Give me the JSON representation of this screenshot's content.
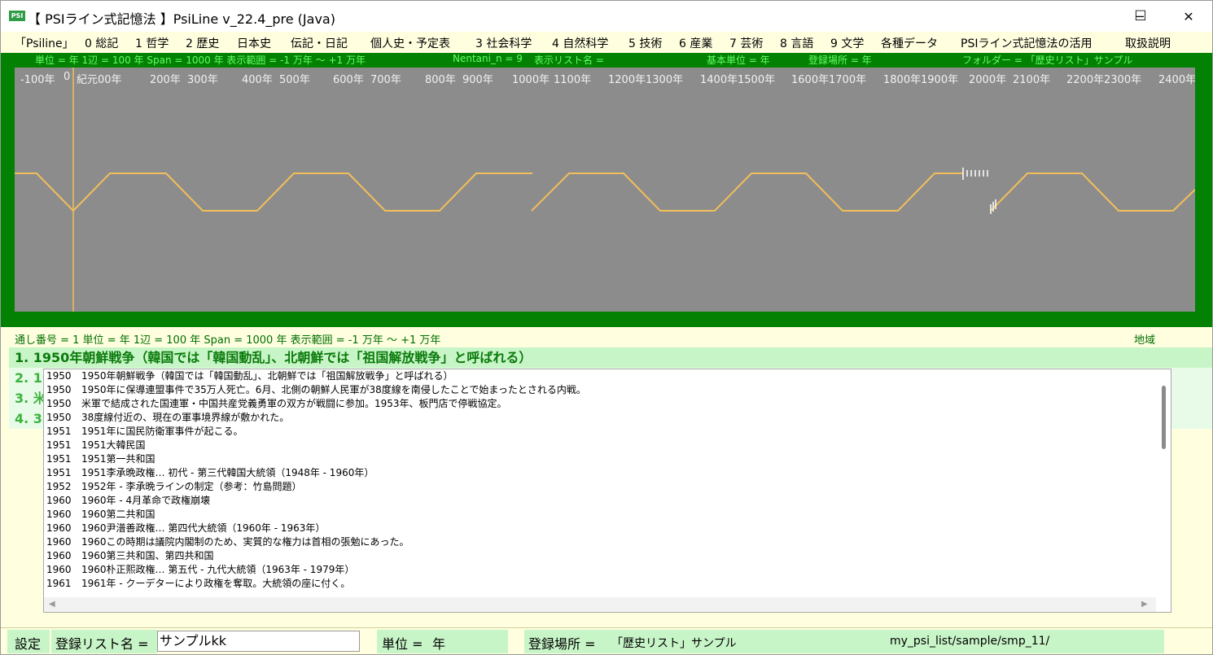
{
  "window": {
    "icon_label": "PSI",
    "title": "【 PSIライン式記憶法 】PsiLine v_22.4_pre (Java)",
    "minimize_glyph": "─",
    "maximize_glyph": "☐",
    "close_glyph": "✕"
  },
  "menu": [
    "「Psiline」",
    "0 総記",
    "1 哲学",
    "2 歴史",
    "日本史",
    "伝記・日記",
    "個人史・予定表",
    "3 社会科学",
    "4 自然科学",
    "5 技術",
    "6 産業",
    "7 芸術",
    "8 言語",
    "9 文学",
    "各種データ",
    "PSIライン式記憶法の活用",
    "取扱説明"
  ],
  "info_bar": {
    "unit": "単位 = 年  1辺 = 100 年  Span = 1000 年  表示範囲 = -1 万年 ～ +1 万年",
    "nentani": "Nentani_n = 9",
    "display_list": "表示リスト名 =",
    "base_unit": "基本単位 = 年",
    "reg_place": "登録場所 = 年",
    "folder": "フォルダー = 「歴史リスト」サンプル"
  },
  "ticks": [
    "-100年",
    "0",
    "紀元00年",
    "200年",
    "300年",
    "400年",
    "500年",
    "600年",
    "700年",
    "800年",
    "900年",
    "1000年",
    "1100年",
    "1200年",
    "1300年",
    "1400年",
    "1500年",
    "1600年",
    "1700年",
    "1800年",
    "1900年",
    "2000年",
    "2100年",
    "2200年",
    "2300年",
    "2400年"
  ],
  "status_line": "通し番号 = 1          単位 = 年  1辺 = 100 年  Span = 1000 年  表示範囲 = -1 万年 ～ +1 万年",
  "region_label": "地域",
  "highlight_rows": [
    "1. 1950年朝鮮戦争（韓国では「韓国動乱」、北朝鮮では「祖国解放戦争」と呼ばれる）",
    "2. 19",
    "3. 米",
    "4. 38"
  ],
  "list": [
    {
      "year": "1950",
      "text": "1950年朝鮮戦争（韓国では「韓国動乱」、北朝鮮では「祖国解放戦争」と呼ばれる）"
    },
    {
      "year": "1950",
      "text": "1950年に保導連盟事件で35万人死亡。6月、北側の朝鮮人民軍が38度線を南侵したことで始まったとされる内戦。"
    },
    {
      "year": "1950",
      "text": "米軍で結成された国連軍・中国共産党義勇軍の双方が戦闘に参加。1953年、板門店で停戦協定。"
    },
    {
      "year": "1950",
      "text": "38度線付近の、現在の軍事境界線が敷かれた。"
    },
    {
      "year": "1951",
      "text": "1951年に国民防衛軍事件が起こる。"
    },
    {
      "year": "1951",
      "text": "1951大韓民国"
    },
    {
      "year": "1951",
      "text": "1951第一共和国"
    },
    {
      "year": "1951",
      "text": "1951李承晩政権… 初代 - 第三代韓国大統領（1948年 - 1960年）"
    },
    {
      "year": "1952",
      "text": "1952年 - 李承晩ラインの制定（参考：竹島問題）"
    },
    {
      "year": "1960",
      "text": "1960年 - 4月革命で政権崩壊"
    },
    {
      "year": "1960",
      "text": "1960第二共和国"
    },
    {
      "year": "1960",
      "text": "1960尹潽善政権… 第四代大統領（1960年 - 1963年）"
    },
    {
      "year": "1960",
      "text": "1960この時期は議院内閣制のため、実質的な権力は首相の張勉にあった。"
    },
    {
      "year": "1960",
      "text": "1960第三共和国、第四共和国"
    },
    {
      "year": "1960",
      "text": "1960朴正熙政権… 第五代 - 九代大統領（1963年 - 1979年）"
    },
    {
      "year": "1961",
      "text": "1961年 - クーデターにより政権を奪取。大統領の座に付く。"
    }
  ],
  "bottom": {
    "settings": "設定",
    "list_name_label": "登録リスト名 =",
    "list_name_value": "サンプルkk",
    "unit_label": "単位 =",
    "unit_value": "年",
    "place_label": "登録場所 =",
    "place_value": "「歴史リスト」サンプル",
    "path": "my_psi_list/sample/smp_11/"
  },
  "colors": {
    "frame_green": "#038103",
    "canvas_gray": "#8c8c8c",
    "line_orange": "#f2be5a",
    "highlight_green": "#c8f5c8",
    "text_green": "#006e00",
    "panel_cream": "#ffffe0"
  }
}
